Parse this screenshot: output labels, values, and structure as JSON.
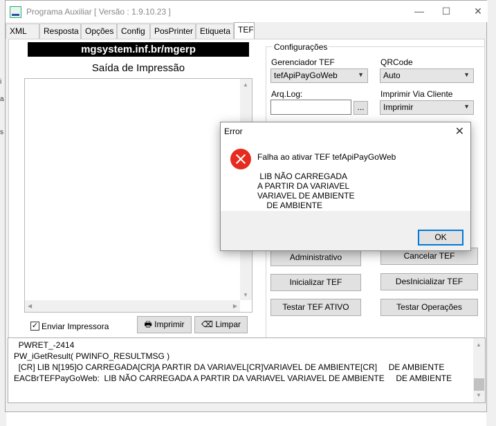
{
  "window": {
    "title": "Programa Auxiliar [ Versão : 1.9.10.23 ]",
    "minimize": "—",
    "maximize": "☐",
    "close": "✕"
  },
  "tabs": [
    "XML",
    "Resposta",
    "Opções",
    "Config",
    "PosPrinter",
    "Etiqueta",
    "TEF"
  ],
  "active_tab": "TEF",
  "left_panel": {
    "url_banner": "mgsystem.inf.br/mgerp",
    "print_title": "Saída de Impressão",
    "send_printer_label": "Enviar Impressora",
    "send_printer_checked": true,
    "print_button": "Imprimir",
    "clear_button": "Limpar"
  },
  "config": {
    "legend": "Configurações",
    "gerenciador_label": "Gerenciador TEF",
    "gerenciador_value": "tefApiPayGoWeb",
    "qrcode_label": "QRCode",
    "qrcode_value": "Auto",
    "arqlog_label": "Arq.Log:",
    "arqlog_value": "",
    "browse_button": "...",
    "via_cliente_label": "Imprimir Via Cliente",
    "via_cliente_value": "Imprimir",
    "buttons": {
      "administrativo": "Administrativo",
      "cancelar": "Cancelar TEF",
      "inicializar": "Inicializar TEF",
      "desinicializar": "DesInicializar TEF",
      "testar_ativo": "Testar TEF ATIVO",
      "testar_operacoes": "Testar Operações"
    }
  },
  "log_lines": [
    "  PWRET_-2414",
    "PW_iGetResult( PWINFO_RESULTMSG )",
    "  [CR] LIB N[195]O CARREGADA[CR]A PARTIR DA VARIAVEL[CR]VARIAVEL DE AMBIENTE[CR]     DE AMBIENTE",
    "EACBrTEFPayGoWeb:  LIB NÃO CARREGADA A PARTIR DA VARIAVEL VARIAVEL DE AMBIENTE     DE AMBIENTE"
  ],
  "dialog": {
    "title": "Error",
    "message_line1": "Falha ao ativar TEF tefApiPayGoWeb",
    "message_line2": " LIB NÃO CARREGADA",
    "message_line3": "A PARTIR DA VARIAVEL",
    "message_line4": "VARIAVEL DE AMBIENTE",
    "message_line5": "    DE AMBIENTE",
    "ok_button": "OK"
  },
  "colors": {
    "accent": "#0078d7",
    "error": "#e52c1f",
    "banner": "#000000"
  }
}
